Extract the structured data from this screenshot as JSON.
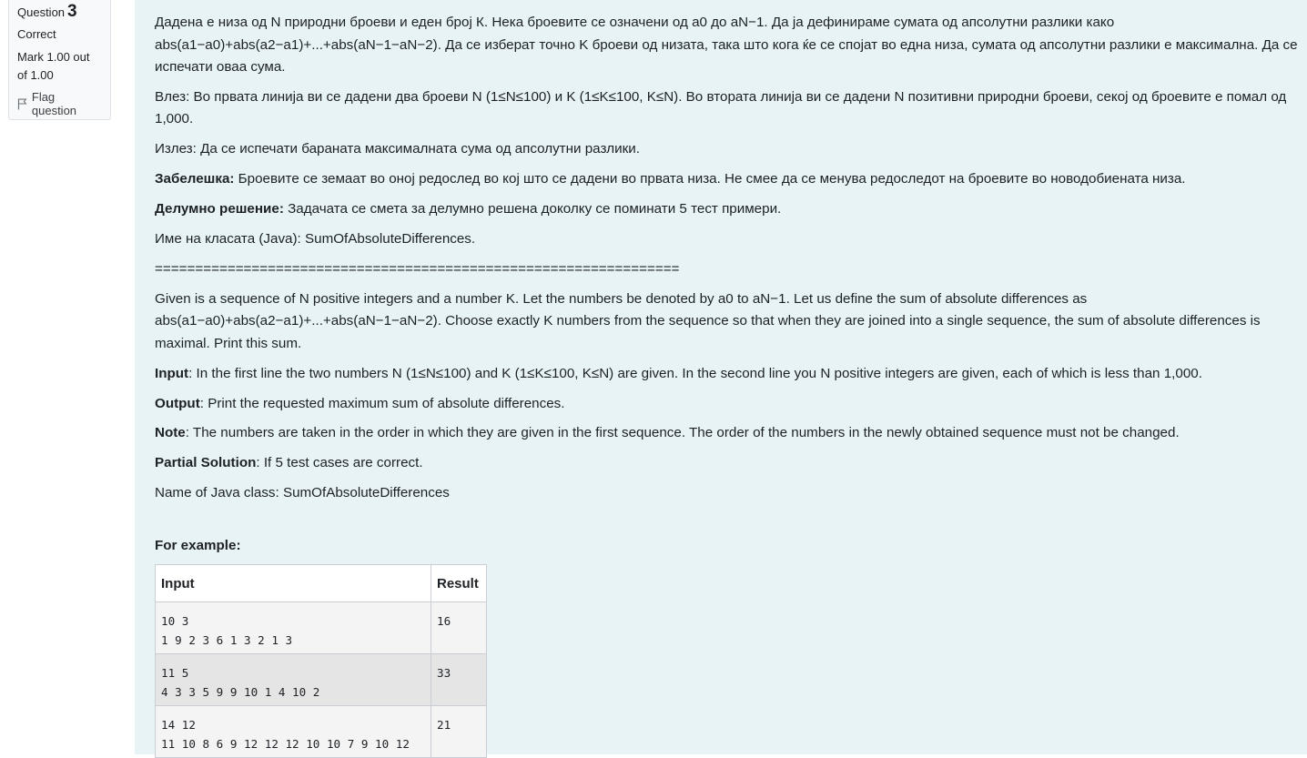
{
  "question_info": {
    "label": "Question",
    "number": "3",
    "state": "Correct",
    "grade": "Mark 1.00 out of 1.00",
    "flag_label": "Flag question"
  },
  "mk": {
    "p1": "Дадена е низа од N природни броеви и еден број К. Нека броевите се означени од a0 до aN−1. Да ја дефинираме сумата од апсолутни разлики како abs(a1−a0)+abs(a2−a1)+...+abs(aN−1−aN−2). Да се изберат точно K броеви од низата, така што кога ќе се спојат во една низа, сумата од апсолутни разлики е максимална. Да се испечати оваа сума.",
    "input": "Влез: Во првата линија ви се дадени два броеви N (1≤N≤100) и K (1≤K≤100, K≤N). Во втората линија ви се дадени N позитивни природни броеви, секој од броевите е помал од 1,000.",
    "output": "Излез: Да се испечати бараната максималната сума од апсолутни разлики.",
    "note_label": "Забелешка:",
    "note": " Броевите се земаат во оној редослед во кој што се дадени во првата низа. Не смее да се менува редоследот на броевите во новодобиената низа.",
    "partial_label": "Делумно решение:",
    "partial": " Задачата се смета за делумно решена доколку се поминати 5 тест примери.",
    "classname": "Име на класата (Java): SumOfAbsoluteDifferences."
  },
  "separator": "=================================================================",
  "en": {
    "p1": "Given is a sequence of N positive integers and a number K. Let the numbers be denoted by a0 to aN−1. Let us define the sum of absolute differences as abs(a1−a0)+abs(a2−a1)+...+abs(aN−1−aN−2). Choose exactly K numbers from the sequence so that when they are joined into a single sequence, the sum of absolute differences is maximal. Print this sum.",
    "input_label": "Input",
    "input": ": In the first line the two numbers N (1≤N≤100) and K (1≤K≤100, K≤N) are given. In the second line you N positive integers are given, each of which is less than 1,000.",
    "output_label": "Output",
    "output": ": Print the requested maximum sum of absolute differences.",
    "note_label": "Note",
    "note": ": The numbers are taken in the order in which they are given in the first sequence. The order of the numbers in the newly obtained sequence must not be changed.",
    "partial_label": "Partial Solution",
    "partial": ": If 5 test cases are correct.",
    "classname": "Name of Java class: SumOfAbsoluteDifferences"
  },
  "examples": {
    "title": "For example:",
    "col_input": "Input",
    "col_result": "Result",
    "rows": [
      {
        "line1": "10 3",
        "line2": "1 9 2 3 6 1 3 2 1 3",
        "result": "16"
      },
      {
        "line1": "11 5",
        "line2": "4 3 3 5 9 9 10 1 4 10 2",
        "result": "33"
      },
      {
        "line1": "14 12",
        "line2": "11 10 8 6 9 12 12 12 10 10 7 9 10 12",
        "result": "21"
      }
    ]
  }
}
